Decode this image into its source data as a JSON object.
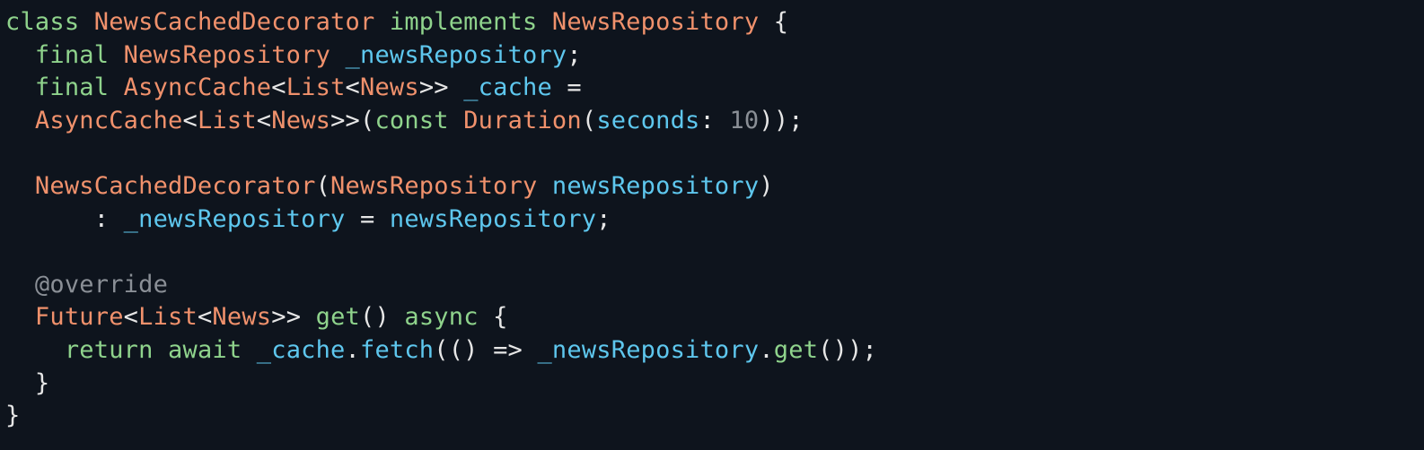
{
  "editor": {
    "theme": {
      "background": "#0e141d",
      "keyword": "#8fd38c",
      "type": "#f0916c",
      "identifier": "#5ec7ee",
      "number": "#8a8f96",
      "annotation": "#8a8f96",
      "punctuation": "#e6e6e6",
      "plain": "#e6e6e6"
    },
    "lines": [
      [
        {
          "t": "class",
          "k": "keyword"
        },
        {
          "t": " ",
          "k": "plain"
        },
        {
          "t": "NewsCachedDecorator",
          "k": "type"
        },
        {
          "t": " ",
          "k": "plain"
        },
        {
          "t": "implements",
          "k": "keyword"
        },
        {
          "t": " ",
          "k": "plain"
        },
        {
          "t": "NewsRepository",
          "k": "type"
        },
        {
          "t": " {",
          "k": "punctuation"
        }
      ],
      [
        {
          "t": "  ",
          "k": "plain"
        },
        {
          "t": "final",
          "k": "keyword"
        },
        {
          "t": " ",
          "k": "plain"
        },
        {
          "t": "NewsRepository",
          "k": "type"
        },
        {
          "t": " ",
          "k": "plain"
        },
        {
          "t": "_newsRepository",
          "k": "identifier"
        },
        {
          "t": ";",
          "k": "punctuation"
        }
      ],
      [
        {
          "t": "  ",
          "k": "plain"
        },
        {
          "t": "final",
          "k": "keyword"
        },
        {
          "t": " ",
          "k": "plain"
        },
        {
          "t": "AsyncCache",
          "k": "type"
        },
        {
          "t": "<",
          "k": "punctuation"
        },
        {
          "t": "List",
          "k": "type"
        },
        {
          "t": "<",
          "k": "punctuation"
        },
        {
          "t": "News",
          "k": "type"
        },
        {
          "t": ">> ",
          "k": "punctuation"
        },
        {
          "t": "_cache",
          "k": "identifier"
        },
        {
          "t": " =",
          "k": "punctuation"
        }
      ],
      [
        {
          "t": "  ",
          "k": "plain"
        },
        {
          "t": "AsyncCache",
          "k": "type"
        },
        {
          "t": "<",
          "k": "punctuation"
        },
        {
          "t": "List",
          "k": "type"
        },
        {
          "t": "<",
          "k": "punctuation"
        },
        {
          "t": "News",
          "k": "type"
        },
        {
          "t": ">>(",
          "k": "punctuation"
        },
        {
          "t": "const",
          "k": "keyword"
        },
        {
          "t": " ",
          "k": "plain"
        },
        {
          "t": "Duration",
          "k": "type"
        },
        {
          "t": "(",
          "k": "punctuation"
        },
        {
          "t": "seconds",
          "k": "identifier"
        },
        {
          "t": ": ",
          "k": "punctuation"
        },
        {
          "t": "10",
          "k": "number"
        },
        {
          "t": "));",
          "k": "punctuation"
        }
      ],
      [],
      [
        {
          "t": "  ",
          "k": "plain"
        },
        {
          "t": "NewsCachedDecorator",
          "k": "type"
        },
        {
          "t": "(",
          "k": "punctuation"
        },
        {
          "t": "NewsRepository",
          "k": "type"
        },
        {
          "t": " ",
          "k": "plain"
        },
        {
          "t": "newsRepository",
          "k": "identifier"
        },
        {
          "t": ")",
          "k": "punctuation"
        }
      ],
      [
        {
          "t": "      : ",
          "k": "punctuation"
        },
        {
          "t": "_newsRepository",
          "k": "identifier"
        },
        {
          "t": " = ",
          "k": "punctuation"
        },
        {
          "t": "newsRepository",
          "k": "identifier"
        },
        {
          "t": ";",
          "k": "punctuation"
        }
      ],
      [],
      [
        {
          "t": "  ",
          "k": "plain"
        },
        {
          "t": "@override",
          "k": "annotation"
        }
      ],
      [
        {
          "t": "  ",
          "k": "plain"
        },
        {
          "t": "Future",
          "k": "type"
        },
        {
          "t": "<",
          "k": "punctuation"
        },
        {
          "t": "List",
          "k": "type"
        },
        {
          "t": "<",
          "k": "punctuation"
        },
        {
          "t": "News",
          "k": "type"
        },
        {
          "t": ">> ",
          "k": "punctuation"
        },
        {
          "t": "get",
          "k": "keyword"
        },
        {
          "t": "() ",
          "k": "punctuation"
        },
        {
          "t": "async",
          "k": "keyword"
        },
        {
          "t": " {",
          "k": "punctuation"
        }
      ],
      [
        {
          "t": "    ",
          "k": "plain"
        },
        {
          "t": "return",
          "k": "keyword"
        },
        {
          "t": " ",
          "k": "plain"
        },
        {
          "t": "await",
          "k": "keyword"
        },
        {
          "t": " ",
          "k": "plain"
        },
        {
          "t": "_cache",
          "k": "identifier"
        },
        {
          "t": ".",
          "k": "punctuation"
        },
        {
          "t": "fetch",
          "k": "identifier"
        },
        {
          "t": "(() => ",
          "k": "punctuation"
        },
        {
          "t": "_newsRepository",
          "k": "identifier"
        },
        {
          "t": ".",
          "k": "punctuation"
        },
        {
          "t": "get",
          "k": "keyword"
        },
        {
          "t": "());",
          "k": "punctuation"
        }
      ],
      [
        {
          "t": "  }",
          "k": "punctuation"
        }
      ],
      [
        {
          "t": "}",
          "k": "punctuation"
        }
      ]
    ]
  }
}
